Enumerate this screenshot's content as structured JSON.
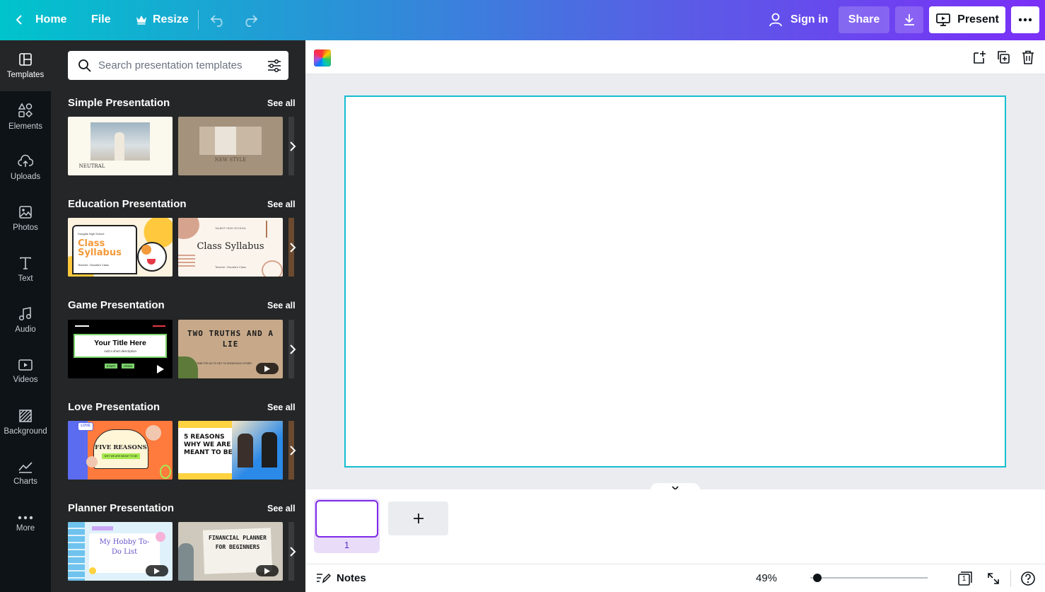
{
  "topbar": {
    "home_label": "Home",
    "file_label": "File",
    "resize_label": "Resize",
    "sign_in_label": "Sign in",
    "share_label": "Share",
    "present_label": "Present"
  },
  "rail": {
    "items": [
      {
        "label": "Templates",
        "icon": "templates-icon"
      },
      {
        "label": "Elements",
        "icon": "elements-icon"
      },
      {
        "label": "Uploads",
        "icon": "uploads-icon"
      },
      {
        "label": "Photos",
        "icon": "photos-icon"
      },
      {
        "label": "Text",
        "icon": "text-icon"
      },
      {
        "label": "Audio",
        "icon": "audio-icon"
      },
      {
        "label": "Videos",
        "icon": "videos-icon"
      },
      {
        "label": "Background",
        "icon": "background-icon"
      },
      {
        "label": "Charts",
        "icon": "charts-icon"
      },
      {
        "label": "More",
        "icon": "more-icon"
      }
    ]
  },
  "panel": {
    "search_placeholder": "Search presentation templates",
    "see_all_label": "See all",
    "sections": [
      {
        "title": "Simple Presentation",
        "thumbs": [
          {
            "text": "NEUTRAL",
            "bg": "#fbf8ee"
          },
          {
            "text": "NEW STYLE",
            "bg": "#a4927c"
          }
        ]
      },
      {
        "title": "Education Presentation",
        "thumbs": [
          {
            "text": "Class Syllabus",
            "sub": "Teacher: Claudia's Class",
            "top": "Douglas High School",
            "bg": "#fdf3df"
          },
          {
            "text": "Class Syllabus",
            "sub": "Teacher: Claudia's Class",
            "top": "TALBOT HIGH SCHOOL",
            "bg": "#fbf4ec"
          }
        ]
      },
      {
        "title": "Game Presentation",
        "thumbs": [
          {
            "text": "Your Title Here",
            "sub": "Add a short description",
            "btn1": "START",
            "btn2": "ITEMS",
            "bg": "#000000"
          },
          {
            "text": "TWO TRUTHS AND A LIE",
            "sub": "TIME FOR US TO GET TO KNOW EACH OTHER",
            "bg": "#c7a98a"
          }
        ]
      },
      {
        "title": "Love Presentation",
        "thumbs": [
          {
            "text": "FIVE REASONS",
            "sub": "WHY WE ARE MEANT TO BE",
            "badge": "LOVE",
            "bg": "#ff7a3d"
          },
          {
            "text": "5 REASONS WHY WE ARE MEANT TO BE",
            "bg": "#ffffff"
          }
        ]
      },
      {
        "title": "Planner Presentation",
        "thumbs": [
          {
            "text": "My Hobby To-Do List",
            "bg": "#dff2fb"
          },
          {
            "text": "FINANCIAL PLANNER FOR BEGINNERS",
            "bg": "#cfc9bd"
          }
        ]
      }
    ]
  },
  "pages": {
    "current": "1"
  },
  "footer": {
    "notes_label": "Notes",
    "zoom_label": "49%",
    "zoom_level": 0.06,
    "page_count": "1"
  },
  "colors": {
    "canvas_outline": "#13bfd0",
    "page_accent": "#7d2ae8",
    "panel_bg": "#252627",
    "rail_bg": "#0e1318"
  }
}
